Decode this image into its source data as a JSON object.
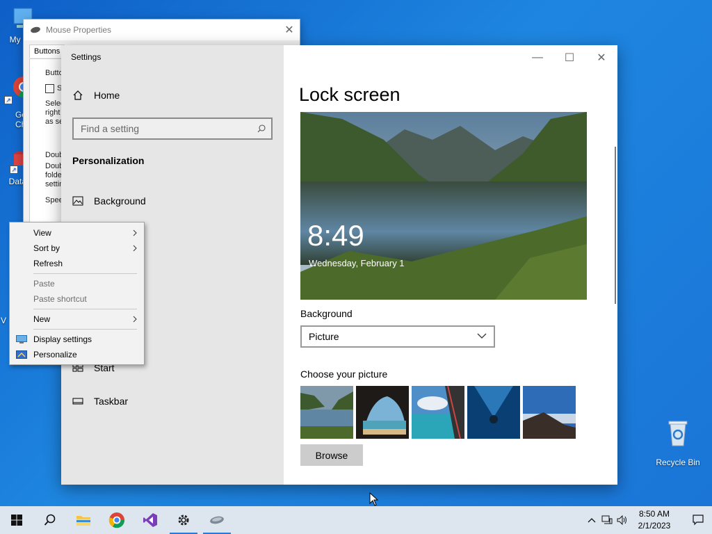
{
  "desktop": {
    "icons": [
      {
        "label": "My Co"
      },
      {
        "label": "Go\nChr"
      },
      {
        "label": "DataW"
      },
      {
        "label": "V"
      },
      {
        "label": "Recycle Bin"
      }
    ]
  },
  "mouse_window": {
    "title": "Mouse Properties",
    "tab": "Buttons",
    "fragments": [
      "Butto",
      "S",
      "Selec",
      "right f",
      "as se",
      "Doub",
      "Doub",
      "folde",
      "settin",
      "Spee"
    ]
  },
  "settings": {
    "app_title": "Settings",
    "home_label": "Home",
    "search_placeholder": "Find a setting",
    "section_title": "Personalization",
    "nav": [
      {
        "label": "Background",
        "icon": "picture-icon"
      },
      {
        "label": "Start",
        "icon": "start-grid-icon"
      },
      {
        "label": "Taskbar",
        "icon": "taskbar-icon"
      }
    ],
    "page_title": "Lock screen",
    "preview_time": "8:49",
    "preview_date": "Wednesday, February 1",
    "background_label": "Background",
    "background_value": "Picture",
    "choose_label": "Choose your picture",
    "browse_label": "Browse"
  },
  "context_menu": {
    "items": [
      {
        "label": "View",
        "submenu": true,
        "enabled": true
      },
      {
        "label": "Sort by",
        "submenu": true,
        "enabled": true
      },
      {
        "label": "Refresh",
        "submenu": false,
        "enabled": true
      },
      {
        "label": "Paste",
        "submenu": false,
        "enabled": false
      },
      {
        "label": "Paste shortcut",
        "submenu": false,
        "enabled": false
      },
      {
        "label": "New",
        "submenu": true,
        "enabled": true
      },
      {
        "label": "Display settings",
        "submenu": false,
        "enabled": true
      },
      {
        "label": "Personalize",
        "submenu": false,
        "enabled": true
      }
    ]
  },
  "taskbar": {
    "apps": [
      "start-icon",
      "search-icon",
      "file-explorer-icon",
      "chrome-icon",
      "visual-studio-icon",
      "settings-gear-icon",
      "mouse-icon"
    ],
    "time": "8:50 AM",
    "date": "2/1/2023"
  },
  "colors": {
    "desktop_blue": "#1b78d8",
    "sidebar_gray": "#e6e6e6",
    "taskbar": "#dde5ef",
    "accent": "#2b7bd6"
  }
}
